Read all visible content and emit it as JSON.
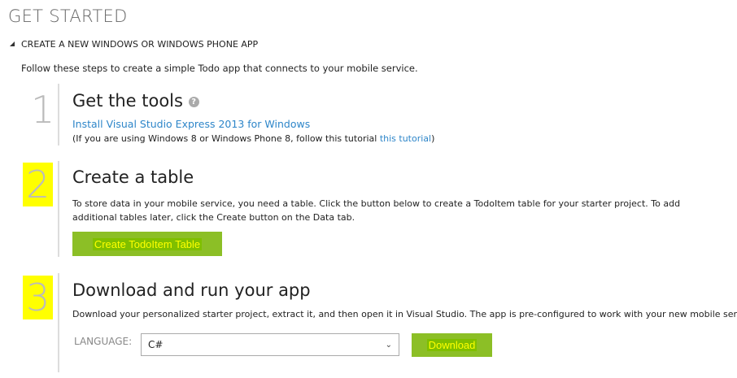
{
  "page_title": "GET STARTED",
  "section": {
    "label": "CREATE A NEW WINDOWS OR WINDOWS PHONE APP"
  },
  "intro": "Follow these steps to create a simple Todo app that connects to your mobile service.",
  "steps": [
    {
      "number": "1",
      "title": "Get the tools",
      "link": "Install Visual Studio Express 2013 for Windows",
      "note_prefix": "(If you are using Windows 8 or Windows Phone 8, follow this tutorial ",
      "note_link": "this tutorial",
      "note_suffix": ")"
    },
    {
      "number": "2",
      "title": "Create a table",
      "desc": "To store data in your mobile service, you need a table. Click the button below to create a TodoItem table for your starter project. To add additional tables later, click the Create button on the Data tab.",
      "button": "Create TodoItem Table"
    },
    {
      "number": "3",
      "title": "Download and run your app",
      "desc": "Download your personalized starter project, extract it, and then open it in Visual Studio. The app is pre-configured to work with your new mobile service.",
      "language_label": "LANGUAGE:",
      "language_value": "C#",
      "button": "Download"
    }
  ],
  "colors": {
    "accent": "#8cbf26",
    "highlight": "#ffff00",
    "link": "#2e86c9"
  }
}
